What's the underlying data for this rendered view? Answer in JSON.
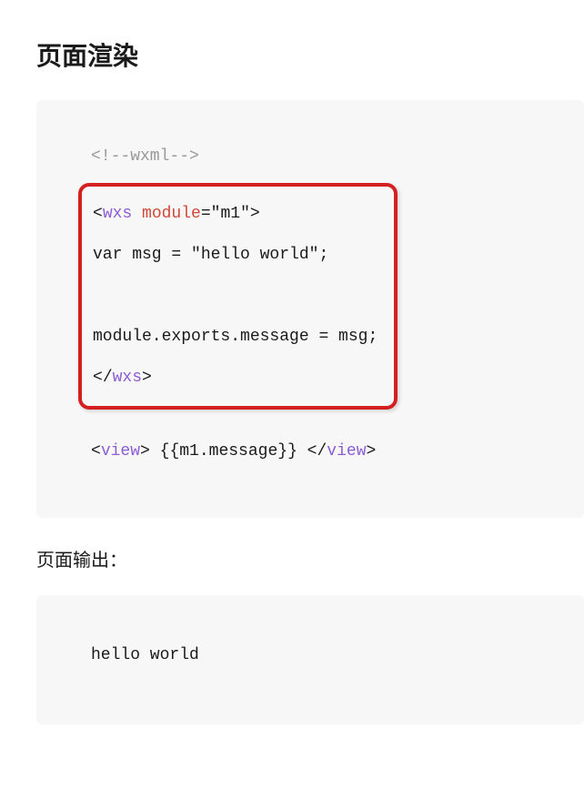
{
  "heading": "页面渲染",
  "code": {
    "commentLine": "<!--wxml-->",
    "line1": {
      "open_lt": "<",
      "tag": "wxs",
      "space1": " ",
      "attr": "module",
      "eq": "=",
      "q1": "\"",
      "val": "m1",
      "q2": "\"",
      "gt": ">"
    },
    "line2": "var msg = \"hello world\";",
    "line3": "",
    "line4": "module.exports.message = msg;",
    "line5": {
      "lt": "<",
      "slash": "/",
      "tag": "wxs",
      "gt": ">"
    },
    "line_view_open": {
      "open_lt": "<",
      "tag": "view",
      "gt": ">"
    },
    "view_content": " {{m1.message}} ",
    "line_view_close": {
      "lt": "<",
      "slash": "/",
      "tag": "view",
      "gt": ">"
    }
  },
  "output_label": "页面输出：",
  "output_text": "hello world"
}
